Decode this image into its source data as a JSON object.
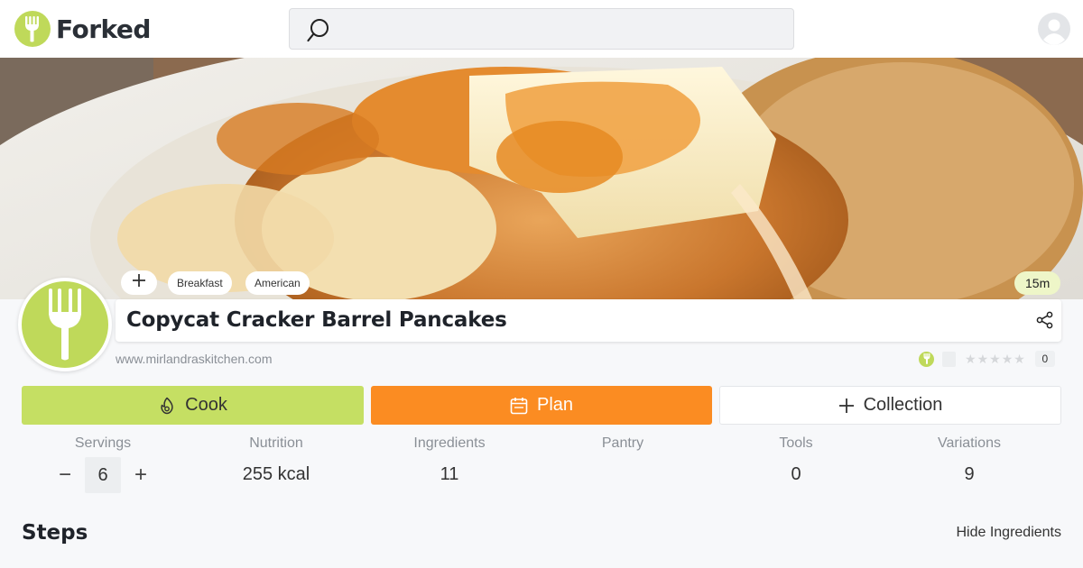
{
  "header": {
    "logo_text": "Forked",
    "search_placeholder": "",
    "icons": {
      "logo": "fork-icon",
      "search": "search-icon",
      "avatar": "user-avatar-icon"
    }
  },
  "hero": {
    "image": "pancake-stack-photo"
  },
  "tags": {
    "add_icon": "plus-icon",
    "items": [
      "Breakfast",
      "American"
    ]
  },
  "time": "15m",
  "recipe": {
    "title": "Copycat Cracker Barrel Pancakes",
    "source": "www.mirlandraskitchen.com",
    "rating_count": "0",
    "star_count_filled": 0
  },
  "actions": {
    "cook": "Cook",
    "plan": "Plan",
    "collection": "Collection"
  },
  "stats": {
    "servings": {
      "label": "Servings",
      "value": "6",
      "minus": "−",
      "plus": "+"
    },
    "nutrition": {
      "label": "Nutrition",
      "value": "255 kcal"
    },
    "ingredients": {
      "label": "Ingredients",
      "value": "11"
    },
    "pantry": {
      "label": "Pantry",
      "value": ""
    },
    "tools": {
      "label": "Tools",
      "value": "0"
    },
    "variations": {
      "label": "Variations",
      "value": "9"
    }
  },
  "steps": {
    "title": "Steps",
    "hide_ingredients": "Hide Ingredients"
  },
  "colors": {
    "brand_green": "#bfd95a",
    "cook_green": "#c5df63",
    "plan_orange": "#fb8c22",
    "time_badge": "#eef6c8"
  }
}
